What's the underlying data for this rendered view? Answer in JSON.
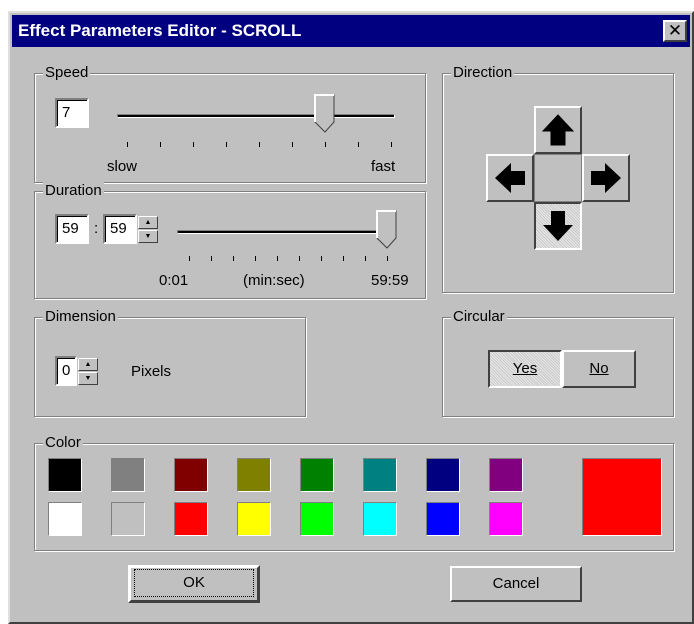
{
  "window": {
    "title": "Effect Parameters Editor - SCROLL",
    "close_glyph": "✕"
  },
  "speed": {
    "legend": "Speed",
    "value": "7",
    "min_label": "slow",
    "max_label": "fast",
    "level": 7,
    "max": 9
  },
  "duration": {
    "legend": "Duration",
    "minutes": "59",
    "separator": ":",
    "seconds": "59",
    "min_label": "0:01",
    "unit_label": "(min:sec)",
    "max_label": "59:59",
    "level": 1.0
  },
  "direction": {
    "legend": "Direction",
    "selected": "down",
    "up_icon": "arrow-up-icon",
    "down_icon": "arrow-down-icon",
    "left_icon": "arrow-left-icon",
    "right_icon": "arrow-right-icon"
  },
  "dimension": {
    "legend": "Dimension",
    "value": "0",
    "unit": "Pixels"
  },
  "circular": {
    "legend": "Circular",
    "yes_label": "Yes",
    "no_label": "No",
    "selected": "Yes"
  },
  "color": {
    "legend": "Color",
    "row1": [
      "#000000",
      "#808080",
      "#800000",
      "#808000",
      "#008000",
      "#008080",
      "#000080",
      "#800080"
    ],
    "row2": [
      "#ffffff",
      "#c0c0c0",
      "#ff0000",
      "#ffff00",
      "#00ff00",
      "#00ffff",
      "#0000ff",
      "#ff00ff"
    ],
    "selected": "#ff0000"
  },
  "buttons": {
    "ok_label": "OK",
    "cancel_label": "Cancel"
  }
}
